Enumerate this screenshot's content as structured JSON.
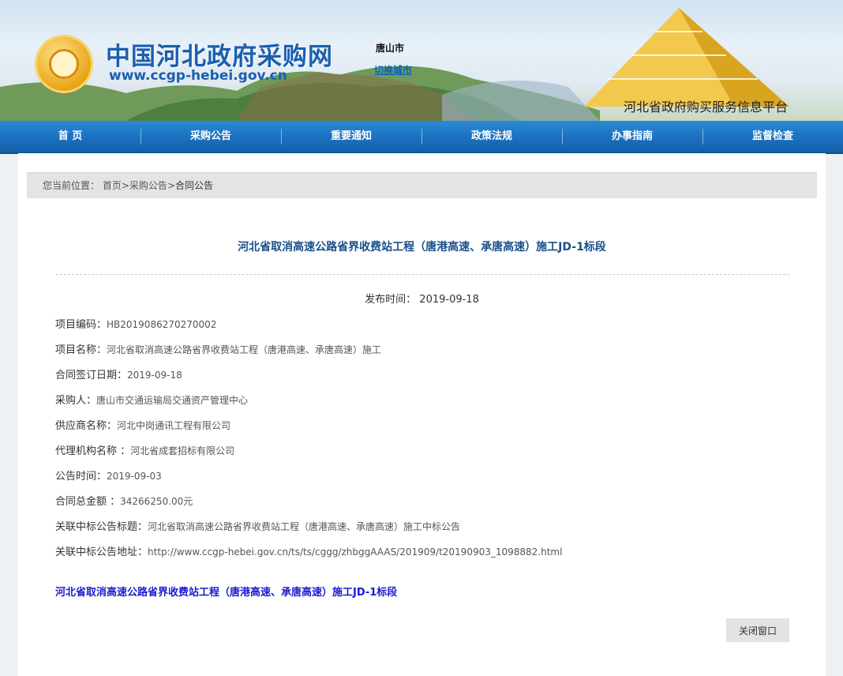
{
  "header": {
    "site_title": "中国河北政府采购网",
    "site_url": "www.ccgp-hebei.gov.cn",
    "city": "唐山市",
    "switch_city": "切换城市",
    "platform": "河北省政府购买服务信息平台"
  },
  "nav": [
    {
      "label": "首 页"
    },
    {
      "label": "采购公告"
    },
    {
      "label": "重要通知"
    },
    {
      "label": "政策法规"
    },
    {
      "label": "办事指南"
    },
    {
      "label": "监督检查"
    }
  ],
  "breadcrumb": {
    "label": "您当前位置：",
    "items": [
      "首页",
      "采购公告",
      "合同公告"
    ],
    "sep": ">"
  },
  "article": {
    "title": "河北省取消高速公路省界收费站工程（唐港高速、承唐高速）施工JD-1标段",
    "pubtime_label": "发布时间：",
    "pubtime": "2019-09-18",
    "fields": [
      {
        "label": "项目编码：",
        "value": "HB2019086270270002"
      },
      {
        "label": "项目名称：",
        "value": "河北省取消高速公路省界收费站工程（唐港高速、承唐高速）施工"
      },
      {
        "label": "合同签订日期：",
        "value": "2019-09-18"
      },
      {
        "label": "采购人：",
        "value": "唐山市交通运输局交通资产管理中心"
      },
      {
        "label": "供应商名称：",
        "value": "河北中岗通讯工程有限公司"
      },
      {
        "label": "代理机构名称 ：",
        "value": "河北省成套招标有限公司"
      },
      {
        "label": "公告时间：",
        "value": "2019-09-03"
      },
      {
        "label": "合同总金额 ：",
        "value": "34266250.00元"
      },
      {
        "label": "关联中标公告标题：",
        "value": "河北省取消高速公路省界收费站工程（唐港高速、承唐高速）施工中标公告"
      },
      {
        "label": "关联中标公告地址：",
        "value": "http://www.ccgp-hebei.gov.cn/ts/ts/cggg/zhbggAAAS/201909/t20190903_1098882.html"
      }
    ],
    "link_title": "河北省取消高速公路省界收费站工程（唐港高速、承唐高速）施工JD-1标段",
    "close_label": "关闭窗口"
  }
}
